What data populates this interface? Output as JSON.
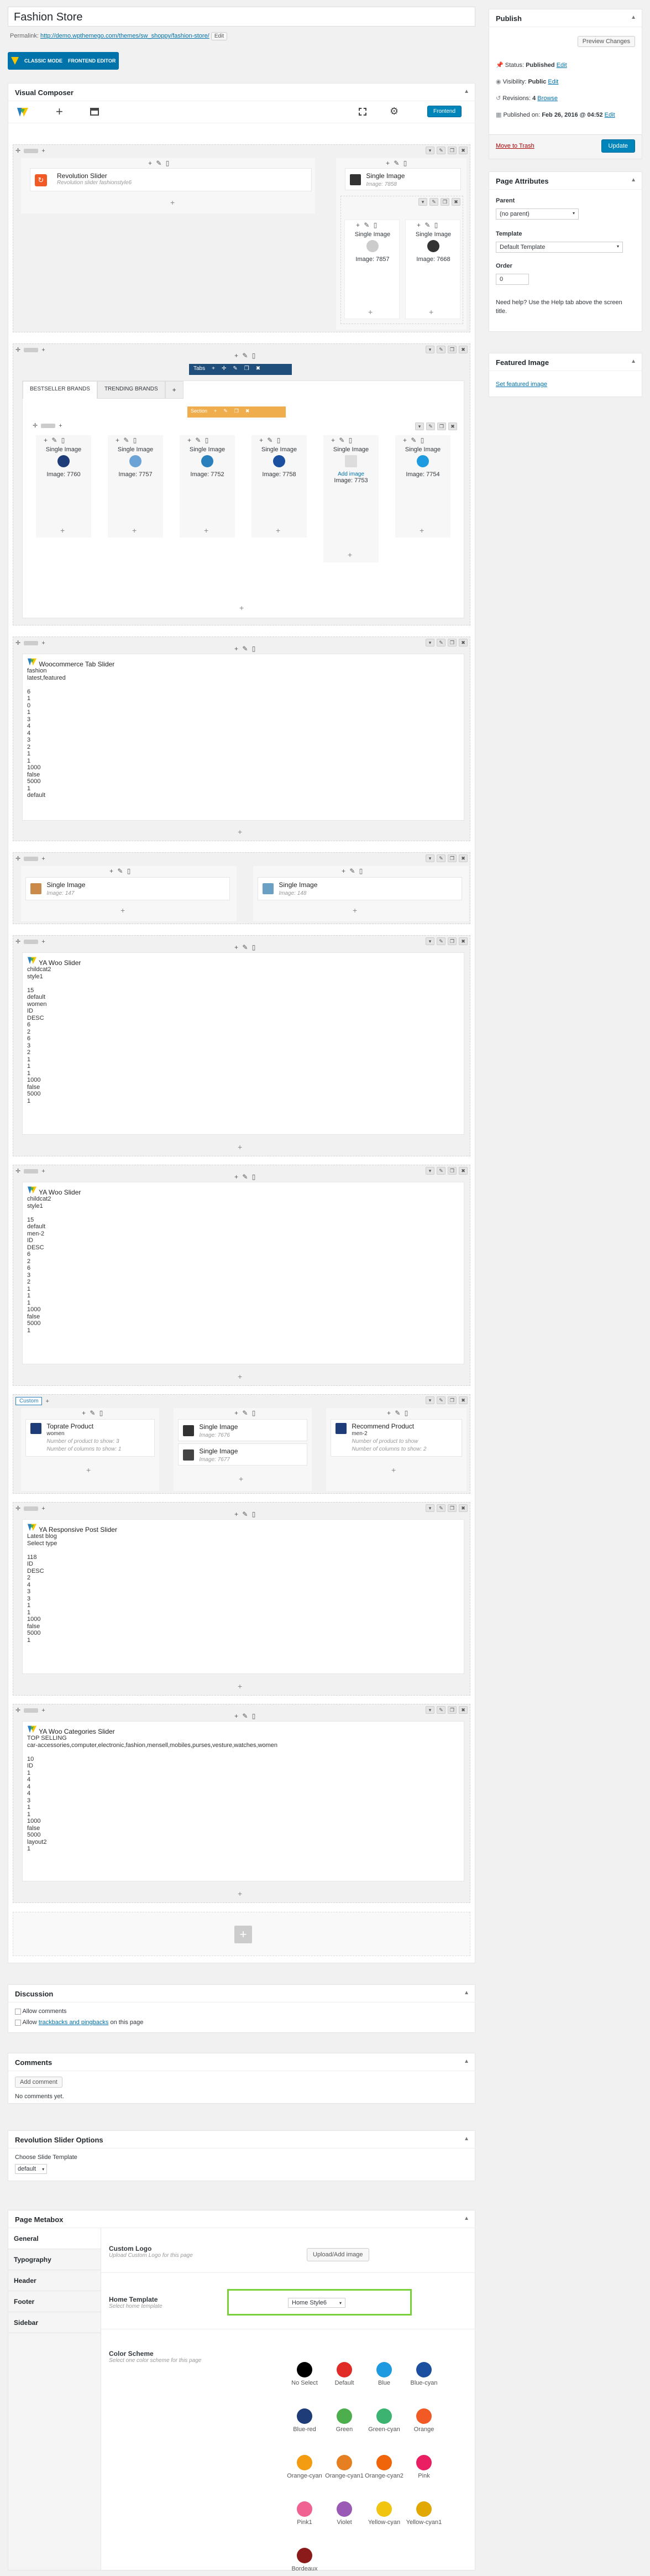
{
  "page": {
    "title": "Fashion Store",
    "permalink_label": "Permalink:",
    "permalink_url": "http://demo.wpthemego.com/themes/sw_shoppy/fashion-store/",
    "edit_label": "Edit",
    "classic_mode": "CLASSIC MODE",
    "frontend_editor": "FRONTEND EDITOR"
  },
  "publish": {
    "title": "Publish",
    "preview_label": "Preview Changes",
    "status_label": "Status:",
    "status_value": "Published",
    "status_edit": "Edit",
    "visibility_label": "Visibility:",
    "visibility_value": "Public",
    "visibility_edit": "Edit",
    "revisions_label": "Revisions:",
    "revisions_value": "4",
    "revisions_browse": "Browse",
    "published_label": "Published on:",
    "published_value": "Feb 26, 2016 @ 04:52",
    "published_edit": "Edit",
    "trash_label": "Move to Trash",
    "update_label": "Update"
  },
  "page_attributes": {
    "title": "Page Attributes",
    "parent_label": "Parent",
    "parent_value": "(no parent)",
    "template_label": "Template",
    "template_value": "Default Template",
    "order_label": "Order",
    "order_value": "0",
    "help_text": "Need help? Use the Help tab above the screen title."
  },
  "featured_image": {
    "title": "Featured Image",
    "link_label": "Set featured image"
  },
  "vc": {
    "title": "Visual Composer",
    "frontend_btn": "Frontend",
    "rev_slider_title": "Revolution Slider",
    "rev_slider_sub": "Revolution slider fashionstyle6",
    "single_image_label": "Single Image",
    "single_image_sub_1": "Image: 7858",
    "single_image_sub_2": "Image: 7857",
    "single_image_sub_3": "Image: 7668",
    "tabs_label": "Tabs",
    "tab_1": "BESTSELLER BRANDS",
    "tab_2": "TRENDING BRANDS",
    "section_label": "Section",
    "brand_imgs": [
      "Image: 7760",
      "Image: 7757",
      "Image: 7752",
      "Image: 7758",
      "Image: 7753",
      "Image: 7754"
    ],
    "add_image_label": "Add image",
    "woo_tab_title": "Woocommerce Tab Slider",
    "woo_tab_params": "fashion\nlatest,featured\n\n6\n1\n0\n1\n3\n4\n4\n3\n2\n1\n1\n1000\nfalse\n5000\n1\ndefault",
    "single_image_147": "Image: 147",
    "single_image_148": "Image: 148",
    "ya_woo_title": "YA Woo Slider",
    "ya_woo_params_1": "childcat2\nstyle1\n\n15\ndefault\nwomen\nID\nDESC\n6\n2\n6\n3\n2\n1\n1\n1\n1000\nfalse\n5000\n1",
    "ya_woo_params_2": "childcat2\nstyle1\n\n15\ndefault\nmen-2\nID\nDESC\n6\n2\n6\n3\n2\n1\n1\n1\n1000\nfalse\n5000\n1",
    "custom_label": "Custom",
    "toprate_title": "Toprate Product",
    "toprate_sub1": "women",
    "toprate_sub2": "Number of product to show: 3",
    "toprate_sub3": "Number of columns to show: 1",
    "single_image_7676": "Image: 7676",
    "single_image_7677": "Image: 7677",
    "recommend_title": "Recommend Product",
    "recommend_sub1": "men-2",
    "recommend_sub2": "Number of product to show",
    "recommend_sub3": "Number of columns to show: 2",
    "resp_post_title": "YA Responsive Post Slider",
    "resp_post_params": "Latest blog\nSelect type\n\n118\nID\nDESC\n2\n4\n3\n3\n1\n1\n1000\nfalse\n5000\n1",
    "cat_slider_title": "YA Woo Categories Slider",
    "cat_slider_params": "TOP SELLING\ncar-accessories,computer,electronic,fashion,mensell,mobiles,purses,vesture,watches,women\n\n10\nID\n1\n4\n4\n4\n3\n1\n1\n1000\nfalse\n5000\nlayout2\n1"
  },
  "discussion": {
    "title": "Discussion",
    "allow_comments": "Allow comments",
    "allow_trackbacks_pre": "Allow",
    "allow_trackbacks_link": "trackbacks and pingbacks",
    "allow_trackbacks_post": "on this page"
  },
  "comments": {
    "title": "Comments",
    "add_label": "Add comment",
    "none_label": "No comments yet."
  },
  "rev_options": {
    "title": "Revolution Slider Options",
    "choose_label": "Choose Slide Template",
    "choose_value": "default"
  },
  "metabox": {
    "title": "Page Metabox",
    "tabs": [
      "General",
      "Typography",
      "Header",
      "Footer",
      "Sidebar"
    ],
    "custom_logo_title": "Custom Logo",
    "custom_logo_desc": "Upload Custom Logo for this page",
    "upload_btn": "Upload/Add image",
    "home_template_title": "Home Template",
    "home_template_desc": "Select home template",
    "home_template_value": "Home Style6",
    "color_scheme_title": "Color Scheme",
    "color_scheme_desc": "Select one color scheme for this page",
    "colors": [
      {
        "name": "No Select",
        "hex": "#000000"
      },
      {
        "name": "Default",
        "hex": "#e02b27"
      },
      {
        "name": "Blue",
        "hex": "#1e9be0"
      },
      {
        "name": "Blue-cyan",
        "hex": "#1b4fa0"
      },
      {
        "name": "Blue-red",
        "hex": "#1d3c78"
      },
      {
        "name": "Green",
        "hex": "#4cae4c"
      },
      {
        "name": "Green-cyan",
        "hex": "#3cb371"
      },
      {
        "name": "Orange",
        "hex": "#f15a24"
      },
      {
        "name": "Orange-cyan",
        "hex": "#f39c12"
      },
      {
        "name": "Orange-cyan1",
        "hex": "#e67e22"
      },
      {
        "name": "Orange-cyan2",
        "hex": "#f0650a"
      },
      {
        "name": "Pink",
        "hex": "#e91e63"
      },
      {
        "name": "Pink1",
        "hex": "#f06292"
      },
      {
        "name": "Violet",
        "hex": "#9b59b6"
      },
      {
        "name": "Yellow-cyan",
        "hex": "#f1c40f"
      },
      {
        "name": "Yellow-cyan1",
        "hex": "#e0a800"
      },
      {
        "name": "Bordeaux",
        "hex": "#8b1a1a"
      }
    ]
  },
  "colors": {
    "accent": "#0073aa",
    "vc_blue": "#2a7fbd",
    "section_orange": "#f0ad4e",
    "highlight_green": "#7ad03a"
  }
}
